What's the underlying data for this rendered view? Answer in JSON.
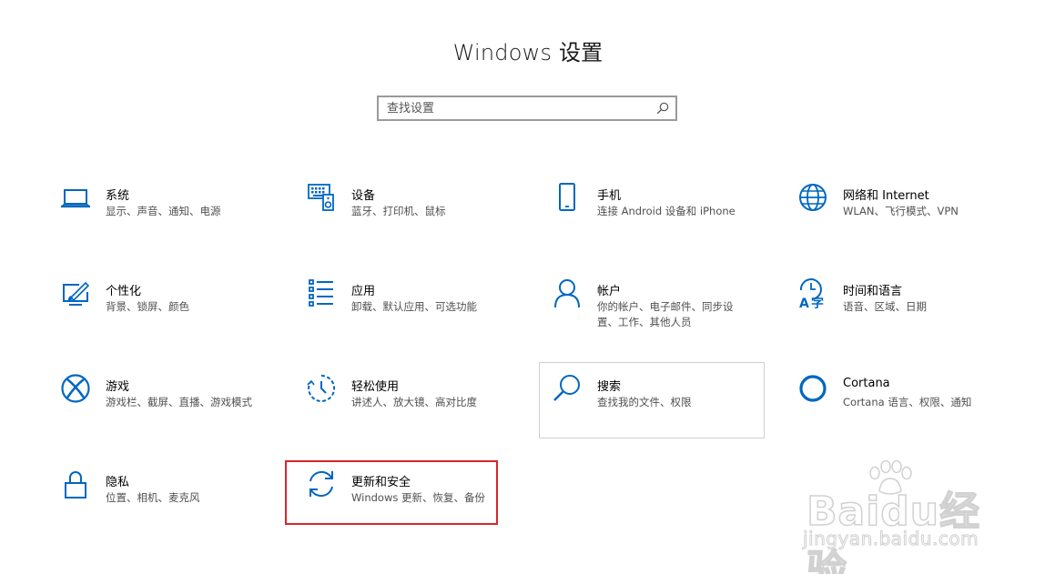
{
  "window": {
    "title": "Windows 设置"
  },
  "search": {
    "placeholder": "查找设置"
  },
  "tiles": [
    {
      "name": "系统",
      "desc": "显示、声音、通知、电源",
      "icon": "laptop-icon"
    },
    {
      "name": "设备",
      "desc": "蓝牙、打印机、鼠标",
      "icon": "keyboard-speaker-icon"
    },
    {
      "name": "手机",
      "desc": "连接 Android 设备和 iPhone",
      "icon": "phone-icon"
    },
    {
      "name": "网络和 Internet",
      "desc": "WLAN、飞行模式、VPN",
      "icon": "globe-icon"
    },
    {
      "name": "个性化",
      "desc": "背景、锁屏、颜色",
      "icon": "paint-monitor-icon"
    },
    {
      "name": "应用",
      "desc": "卸载、默认应用、可选功能",
      "icon": "app-list-icon"
    },
    {
      "name": "帐户",
      "desc": "你的帐户、电子邮件、同步设置、工作、其他人员",
      "icon": "person-icon"
    },
    {
      "name": "时间和语言",
      "desc": "语音、区域、日期",
      "icon": "time-language-icon"
    },
    {
      "name": "游戏",
      "desc": "游戏栏、截屏、直播、游戏模式",
      "icon": "xbox-icon"
    },
    {
      "name": "轻松使用",
      "desc": "讲述人、放大镜、高对比度",
      "icon": "ease-of-access-icon"
    },
    {
      "name": "搜索",
      "desc": "查找我的文件、权限",
      "icon": "search-icon"
    },
    {
      "name": "Cortana",
      "desc": "Cortana 语言、权限、通知",
      "icon": "cortana-icon"
    },
    {
      "name": "隐私",
      "desc": "位置、相机、麦克风",
      "icon": "lock-icon"
    },
    {
      "name": "更新和安全",
      "desc": "Windows 更新、恢复、备份",
      "icon": "sync-icon"
    }
  ],
  "watermark": {
    "brand": "Baidu经验",
    "site": "jingyan.baidu.com"
  },
  "colors": {
    "accent": "#0067c0",
    "highlight": "#d9252a"
  }
}
